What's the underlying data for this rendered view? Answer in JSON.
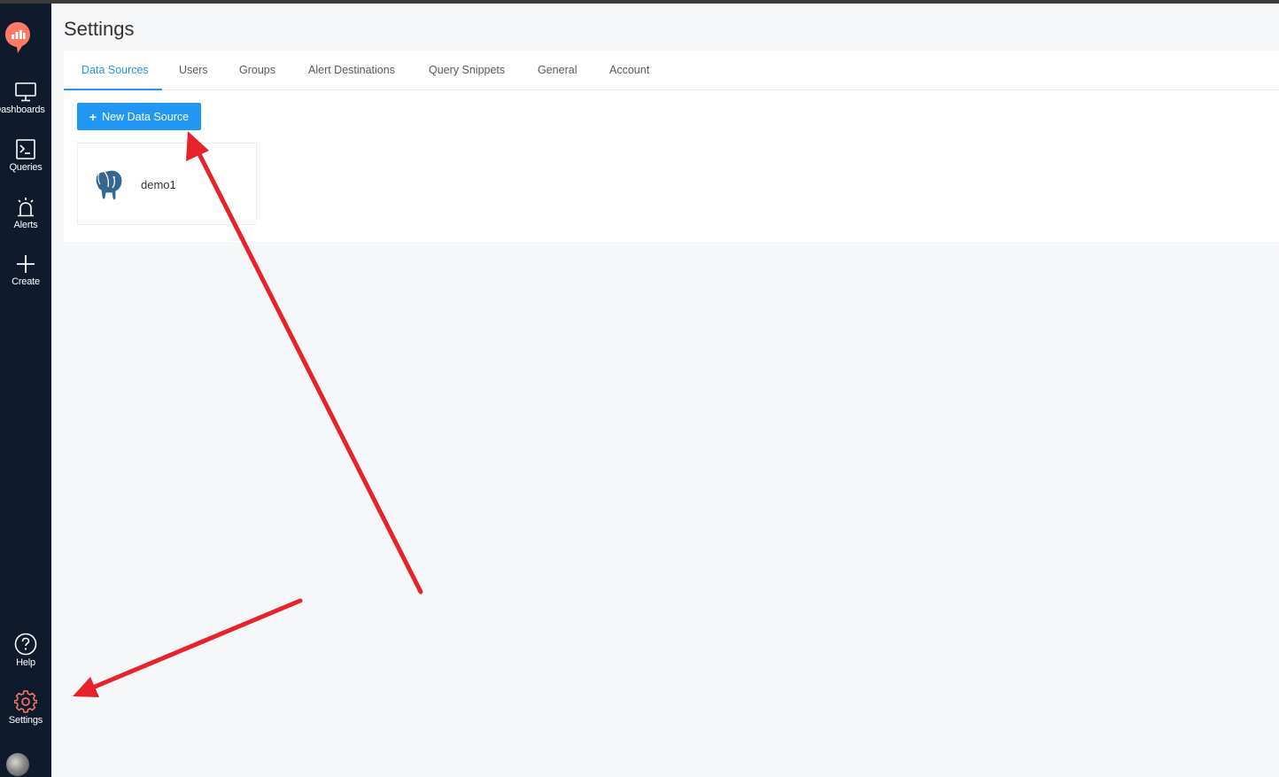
{
  "page": {
    "title": "Settings"
  },
  "sidebar": {
    "items": [
      {
        "label": "Dashboards",
        "icon": "monitor-icon"
      },
      {
        "label": "Queries",
        "icon": "terminal-icon"
      },
      {
        "label": "Alerts",
        "icon": "alarm-icon"
      },
      {
        "label": "Create",
        "icon": "plus-icon"
      }
    ],
    "bottom_items": [
      {
        "label": "Help",
        "icon": "help-circle-icon"
      },
      {
        "label": "Settings",
        "icon": "gear-icon",
        "active": true
      }
    ]
  },
  "tabs": [
    {
      "label": "Data Sources",
      "active": true
    },
    {
      "label": "Users"
    },
    {
      "label": "Groups"
    },
    {
      "label": "Alert Destinations"
    },
    {
      "label": "Query Snippets"
    },
    {
      "label": "General"
    },
    {
      "label": "Account"
    }
  ],
  "toolbar": {
    "new_button_label": "New Data Source",
    "new_button_icon": "plus-icon"
  },
  "data_sources": [
    {
      "name": "demo1",
      "icon": "postgresql-elephant-icon"
    }
  ],
  "colors": {
    "sidebar_bg": "#0f1b2d",
    "accent": "#2196f3",
    "logo": "#ff7964",
    "settings_icon": "#ff7964",
    "annotation_arrow": "#e8222b",
    "page_bg": "#f6f7f9"
  }
}
